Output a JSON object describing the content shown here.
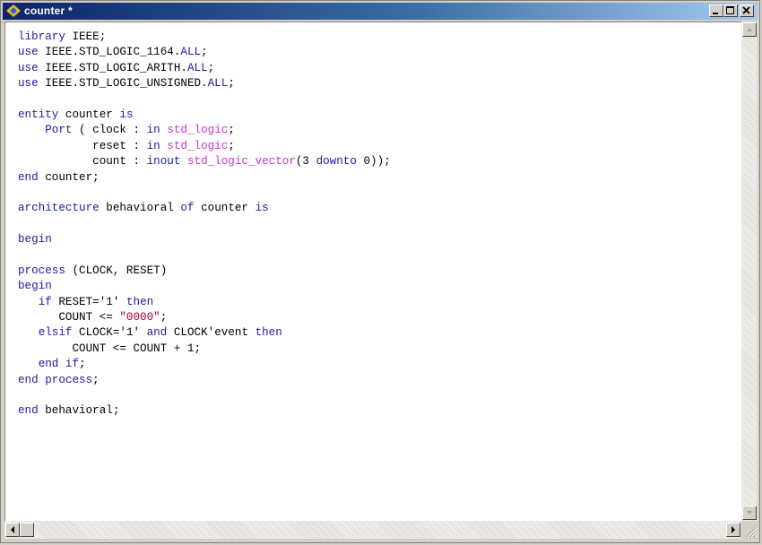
{
  "window": {
    "title": "counter *"
  },
  "code_lines": [
    [
      {
        "t": "library IEEE;",
        "c": "kw-first"
      }
    ],
    [
      {
        "t": "use",
        "c": "kw"
      },
      {
        "t": " IEEE.STD_LOGIC_1164.",
        "c": ""
      },
      {
        "t": "ALL",
        "c": "kw"
      },
      {
        "t": ";",
        "c": ""
      }
    ],
    [
      {
        "t": "use",
        "c": "kw"
      },
      {
        "t": " IEEE.STD_LOGIC_ARITH.",
        "c": ""
      },
      {
        "t": "ALL",
        "c": "kw"
      },
      {
        "t": ";",
        "c": ""
      }
    ],
    [
      {
        "t": "use",
        "c": "kw"
      },
      {
        "t": " IEEE.STD_LOGIC_UNSIGNED.",
        "c": ""
      },
      {
        "t": "ALL",
        "c": "kw"
      },
      {
        "t": ";",
        "c": ""
      }
    ],
    [
      {
        "t": "",
        "c": ""
      }
    ],
    [
      {
        "t": "entity",
        "c": "kw"
      },
      {
        "t": " counter ",
        "c": ""
      },
      {
        "t": "is",
        "c": "kw"
      }
    ],
    [
      {
        "t": "    ",
        "c": ""
      },
      {
        "t": "Port",
        "c": "kw"
      },
      {
        "t": " ( clock : ",
        "c": ""
      },
      {
        "t": "in",
        "c": "kw"
      },
      {
        "t": " ",
        "c": ""
      },
      {
        "t": "std_logic",
        "c": "ty"
      },
      {
        "t": ";",
        "c": ""
      }
    ],
    [
      {
        "t": "           reset : ",
        "c": ""
      },
      {
        "t": "in",
        "c": "kw"
      },
      {
        "t": " ",
        "c": ""
      },
      {
        "t": "std_logic",
        "c": "ty"
      },
      {
        "t": ";",
        "c": ""
      }
    ],
    [
      {
        "t": "           count : ",
        "c": ""
      },
      {
        "t": "inout",
        "c": "kw"
      },
      {
        "t": " ",
        "c": ""
      },
      {
        "t": "std_logic_vector",
        "c": "ty"
      },
      {
        "t": "(3 ",
        "c": ""
      },
      {
        "t": "downto",
        "c": "kw"
      },
      {
        "t": " 0));",
        "c": ""
      }
    ],
    [
      {
        "t": "end",
        "c": "kw"
      },
      {
        "t": " counter;",
        "c": ""
      }
    ],
    [
      {
        "t": "",
        "c": ""
      }
    ],
    [
      {
        "t": "architecture",
        "c": "kw"
      },
      {
        "t": " behavioral ",
        "c": ""
      },
      {
        "t": "of",
        "c": "kw"
      },
      {
        "t": " counter ",
        "c": ""
      },
      {
        "t": "is",
        "c": "kw"
      }
    ],
    [
      {
        "t": "",
        "c": ""
      }
    ],
    [
      {
        "t": "begin",
        "c": "kw"
      }
    ],
    [
      {
        "t": "",
        "c": ""
      }
    ],
    [
      {
        "t": "process",
        "c": "kw"
      },
      {
        "t": " (CLOCK, RESET)",
        "c": ""
      }
    ],
    [
      {
        "t": "begin",
        "c": "kw"
      }
    ],
    [
      {
        "t": "   ",
        "c": ""
      },
      {
        "t": "if",
        "c": "kw"
      },
      {
        "t": " RESET='1' ",
        "c": ""
      },
      {
        "t": "then",
        "c": "kw"
      }
    ],
    [
      {
        "t": "      COUNT <= ",
        "c": ""
      },
      {
        "t": "\"0000\"",
        "c": "st"
      },
      {
        "t": ";",
        "c": ""
      }
    ],
    [
      {
        "t": "   ",
        "c": ""
      },
      {
        "t": "elsif",
        "c": "kw"
      },
      {
        "t": " CLOCK='1' ",
        "c": ""
      },
      {
        "t": "and",
        "c": "kw"
      },
      {
        "t": " CLOCK'event ",
        "c": ""
      },
      {
        "t": "then",
        "c": "kw"
      }
    ],
    [
      {
        "t": "        COUNT <= COUNT + 1;",
        "c": ""
      }
    ],
    [
      {
        "t": "   ",
        "c": ""
      },
      {
        "t": "end if",
        "c": "kw"
      },
      {
        "t": ";",
        "c": ""
      }
    ],
    [
      {
        "t": "end process",
        "c": "kw"
      },
      {
        "t": ";",
        "c": ""
      }
    ],
    [
      {
        "t": "",
        "c": ""
      }
    ],
    [
      {
        "t": "end",
        "c": "kw"
      },
      {
        "t": " behavioral;",
        "c": ""
      }
    ]
  ],
  "icons": {
    "app": "vhdl-document-icon",
    "minimize": "minimize-icon",
    "maximize": "maximize-icon",
    "close": "close-icon"
  },
  "colors": {
    "keyword": "#1a1aa6",
    "type": "#cc33cc",
    "string": "#990033",
    "title_gradient_start": "#0a246a",
    "title_gradient_end": "#a6caf0"
  }
}
